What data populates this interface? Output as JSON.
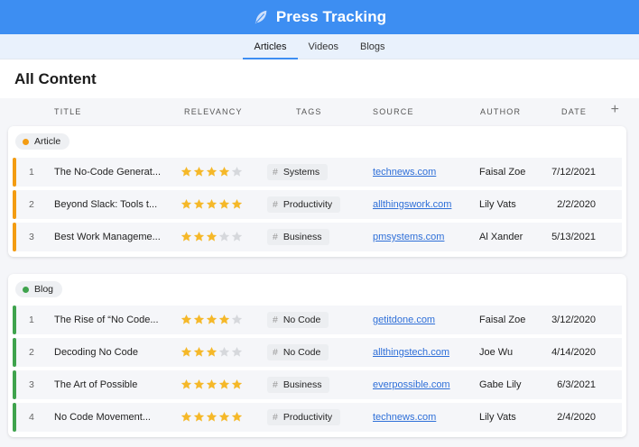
{
  "app": {
    "title": "Press Tracking",
    "logo_icon": "feather-icon",
    "brand_color": "#3d8ef2"
  },
  "nav": {
    "tabs": [
      {
        "label": "Articles",
        "active": true
      },
      {
        "label": "Videos",
        "active": false
      },
      {
        "label": "Blogs",
        "active": false
      }
    ]
  },
  "page": {
    "title": "All Content"
  },
  "columns": {
    "title": "TITLE",
    "relevancy": "RELEVANCY",
    "tags": "TAGS",
    "source": "SOURCE",
    "author": "AUTHOR",
    "date": "DATE",
    "add_icon": "plus-icon"
  },
  "groups": [
    {
      "label": "Article",
      "color": "#f39c12",
      "rows": [
        {
          "num": "1",
          "title": "The No-Code Generat...",
          "rating": 4,
          "tag": "Systems",
          "source": "technews.com",
          "author": "Faisal Zoe",
          "date": "7/12/2021"
        },
        {
          "num": "2",
          "title": "Beyond Slack: Tools t...",
          "rating": 5,
          "tag": "Productivity",
          "source": "allthingswork.com",
          "author": "Lily Vats",
          "date": "2/2/2020"
        },
        {
          "num": "3",
          "title": "Best Work Manageme...",
          "rating": 3,
          "tag": "Business",
          "source": "pmsystems.com",
          "author": "Al Xander",
          "date": "5/13/2021"
        }
      ]
    },
    {
      "label": "Blog",
      "color": "#3fa34d",
      "rows": [
        {
          "num": "1",
          "title": "The Rise of “No Code...",
          "rating": 4,
          "tag": "No Code",
          "source": "getitdone.com",
          "author": "Faisal Zoe",
          "date": "3/12/2020"
        },
        {
          "num": "2",
          "title": "Decoding No Code",
          "rating": 3,
          "tag": "No Code",
          "source": "allthingstech.com",
          "author": "Joe Wu",
          "date": "4/14/2020"
        },
        {
          "num": "3",
          "title": "The Art of Possible",
          "rating": 5,
          "tag": "Business",
          "source": "everpossible.com",
          "author": "Gabe Lily",
          "date": "6/3/2021"
        },
        {
          "num": "4",
          "title": "No Code Movement...",
          "rating": 5,
          "tag": "Productivity",
          "source": "technews.com",
          "author": "Lily Vats",
          "date": "2/4/2020"
        }
      ]
    }
  ],
  "colors": {
    "star_on": "#f5b829",
    "star_off": "#d6d8dc",
    "link": "#2e6fd8"
  }
}
